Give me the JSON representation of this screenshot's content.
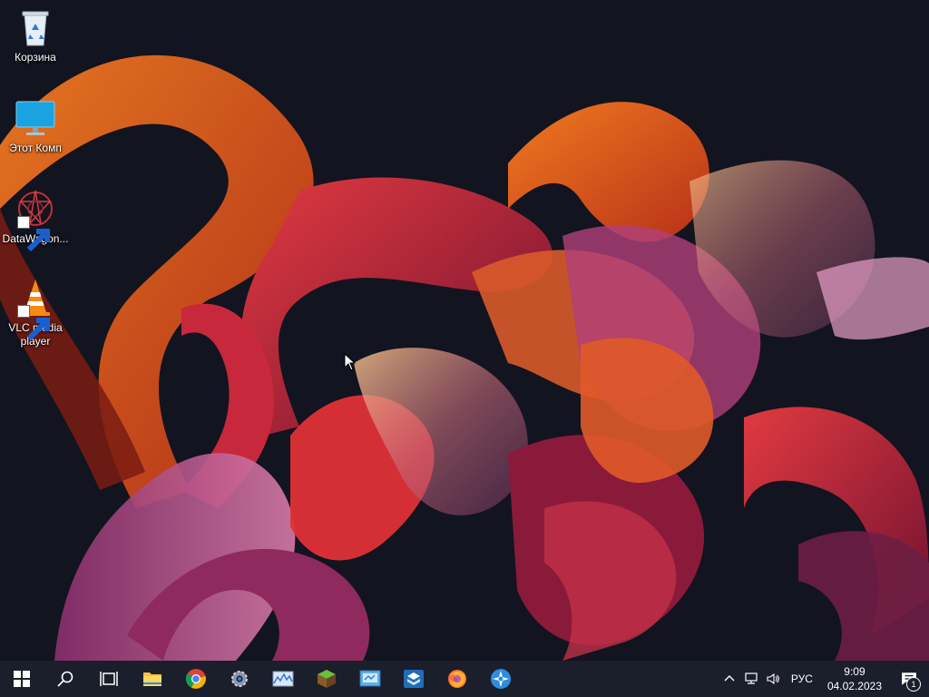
{
  "desktop": {
    "icons": [
      {
        "label": "Корзина",
        "icon": "recycle-bin-icon"
      },
      {
        "label": "Этот Комп",
        "icon": "computer-icon"
      },
      {
        "label": "DataWagon...",
        "icon": "datawagon-icon"
      },
      {
        "label": "VLC media player",
        "icon": "vlc-icon"
      }
    ]
  },
  "taskbar": {
    "apps": [
      "start-icon",
      "search-icon",
      "task-view-icon",
      "file-explorer-icon",
      "chrome-icon",
      "settings-icon",
      "resource-monitor-icon",
      "minecraft-icon",
      "control-panel-icon",
      "virtualbox-icon",
      "firefox-icon",
      "app-icon"
    ],
    "tray": {
      "language": "РУС",
      "time": "9:09",
      "date": "04.02.2023",
      "notification_count": "1"
    }
  },
  "colors": {
    "taskbar": "#1b1e2b",
    "desktop_bg": "#12141f",
    "accent_orange": "#e8641a",
    "accent_red": "#d02a3a",
    "accent_purple": "#a64b8c"
  }
}
